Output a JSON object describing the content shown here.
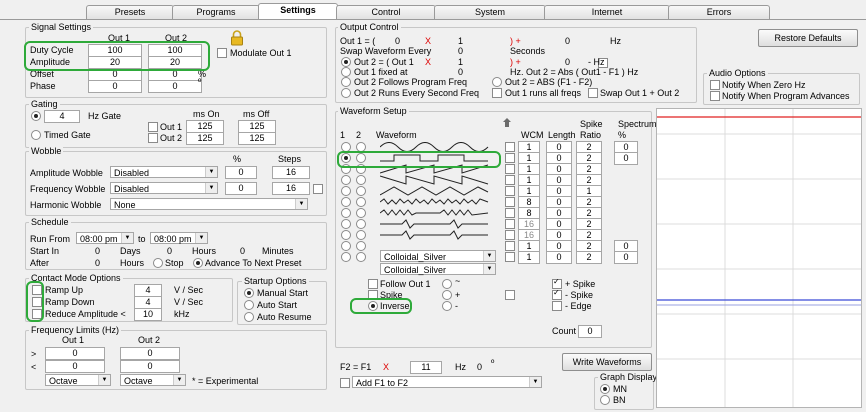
{
  "tabs": [
    "Presets",
    "Programs",
    "Settings",
    "Control",
    "System",
    "Internet",
    "Errors"
  ],
  "signal": {
    "legend": "Signal Settings",
    "out1": "Out 1",
    "out2": "Out 2",
    "rows": [
      {
        "label": "Duty Cycle",
        "v1": "100",
        "v2": "100"
      },
      {
        "label": "Amplitude",
        "v1": "20",
        "v2": "20"
      },
      {
        "label": "Offset",
        "v1": "0",
        "v2": "0"
      },
      {
        "label": "Phase",
        "v1": "0",
        "v2": "0"
      }
    ],
    "percent": "%",
    "deg": "º",
    "modulate": "Modulate Out 1"
  },
  "gating": {
    "legend": "Gating",
    "hz_value": "4",
    "hz_label": "Hz Gate",
    "timed": "Timed Gate",
    "ms_on": "ms On",
    "ms_off": "ms Off",
    "out1": "Out 1",
    "out2": "Out 2",
    "on1": "125",
    "off1": "125",
    "on2": "125",
    "off2": "125"
  },
  "wobble": {
    "legend": "Wobble",
    "pct": "%",
    "steps": "Steps",
    "amp": "Amplitude Wobble",
    "freq": "Frequency Wobble",
    "harm": "Harmonic Wobble",
    "amp_val": "Disabled",
    "freq_val": "Disabled",
    "harm_val": "None",
    "amp_pct": "0",
    "amp_steps": "16",
    "freq_pct": "0",
    "freq_steps": "16"
  },
  "schedule": {
    "legend": "Schedule",
    "run_from": "Run From",
    "from": "08:00 pm",
    "to": "to",
    "to_time": "08:00 pm",
    "start_in": "Start In",
    "days": "Days",
    "hours": "Hours",
    "minutes": "Minutes",
    "after": "After",
    "stop": "Stop",
    "advance": "Advance To Next Preset",
    "z": "0"
  },
  "contact": {
    "legend": "Contact Mode Options",
    "ramp_up": "Ramp Up",
    "ramp_down": "Ramp Down",
    "reduce": "Reduce Amplitude <",
    "up_val": "4",
    "down_val": "4",
    "unit": "V / Sec",
    "reduce_val": "10",
    "khz": "kHz"
  },
  "startup": {
    "legend": "Startup Options",
    "manual": "Manual Start",
    "auto": "Auto Start",
    "resume": "Auto Resume"
  },
  "freq": {
    "legend": "Frequency Limits (Hz)",
    "out1": "Out 1",
    "out2": "Out 2",
    "gt": ">",
    "lt": "<",
    "z": "0",
    "oct1": "Octave",
    "oct2": "Octave",
    "exp": "* = Experimental"
  },
  "output": {
    "legend": "Output Control",
    "line1_a": "Out 1 =  (",
    "line1_v": "0",
    "x": "X",
    "line1_b": "1",
    "paren_plus": ")  +",
    "line1_c": "0",
    "hz": "Hz",
    "swap": "Swap Waveform Every",
    "swap_v": "0",
    "seconds": "Seconds",
    "out2_eq": "Out 2 = (  Out 1",
    "out2_b": "1",
    "out2_c": "0",
    "minus_hz": "-   Hz",
    "fixed": "Out 1 fixed at",
    "fixed_v": "0",
    "abs1": "Hz. Out 2 = Abs ( Out1 - F1 ) Hz",
    "follows": "Out 2 Follows Program Freq",
    "abs2": "Out 2 = ABS (F1 - F2)",
    "runs_every": "Out 2 Runs Every Second Freq",
    "runs_all": "Out 1 runs all freqs",
    "swap_out": "Swap Out 1 + Out 2"
  },
  "restore": "Restore Defaults",
  "audio": {
    "legend": "Audio Options",
    "zero": "Notify When Zero Hz",
    "advance": "Notify When Program Advances"
  },
  "waveform": {
    "legend": "Waveform Setup",
    "c1": "1",
    "c2": "2",
    "wave": "Waveform",
    "wcm": "WCM",
    "len": "Length",
    "spike": "Spike",
    "ratio": "Ratio",
    "spectrum": "Spectrum",
    "pct": "%",
    "wcm_vals": [
      "1",
      "1",
      "1",
      "1",
      "1",
      "8",
      "8",
      "16",
      "16",
      "1",
      "1"
    ],
    "len_vals": [
      "0",
      "0",
      "0",
      "0",
      "0",
      "0",
      "0",
      "0",
      "0",
      "0",
      "0"
    ],
    "ratio_vals": [
      "2",
      "2",
      "2",
      "2",
      "1",
      "2",
      "2",
      "2",
      "2",
      "2",
      "2"
    ],
    "spec_vals": [
      "0",
      "0",
      "",
      "",
      "",
      "",
      "",
      "",
      "",
      "0",
      "0"
    ],
    "colloidal1": "Colloidal_Silver",
    "colloidal2": "Colloidal_Silver",
    "follow": "Follow Out 1",
    "inverse": "Inverse",
    "tilde": "~",
    "plus": "+",
    "minus": "-",
    "plus_spike": "+ Spike",
    "minus_spike": "- Spike",
    "edge": "- Edge",
    "count": "Count",
    "count_v": "0",
    "f2": "F2 = F1",
    "f2_x": "X",
    "f2_v": "11",
    "f2_hz": "Hz",
    "f2_o": "0",
    "deg": "º",
    "write": "Write Waveforms",
    "add": "Add F1 to F2"
  },
  "graph": {
    "legend": "Graph Display",
    "mn": "MN",
    "bn": "BN"
  },
  "colors": {
    "accent": "#2eaa3a",
    "red": "#e02020",
    "blue": "#3a4bd8"
  }
}
